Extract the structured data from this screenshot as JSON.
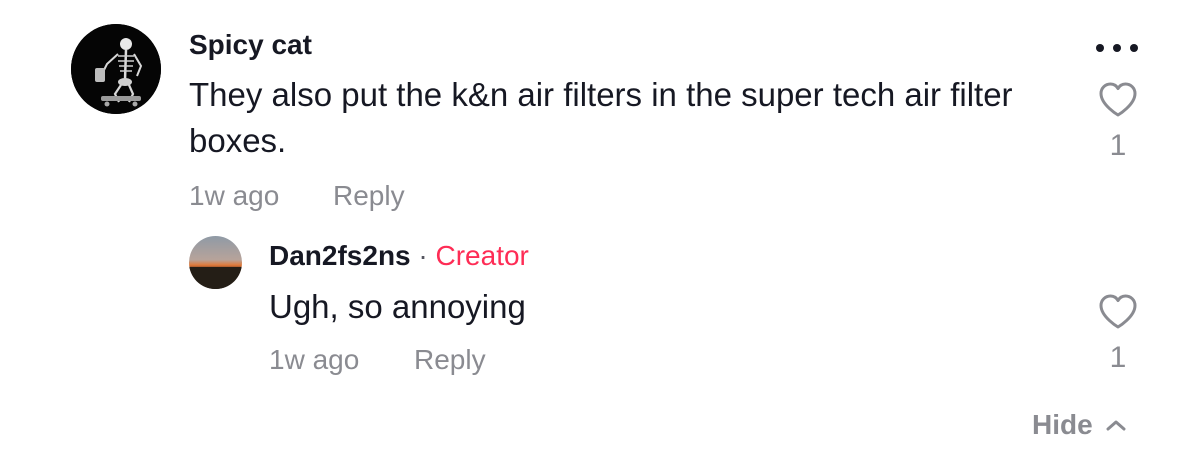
{
  "comment": {
    "username": "Spicy cat",
    "text": "They also put the k&n air filters in the super tech air filter boxes.",
    "time": "1w ago",
    "reply_label": "Reply",
    "like_count": "1",
    "avatar_icon": "skeleton-avatar-icon",
    "more_icon": "more-horizontal-icon",
    "like_icon": "heart-outline-icon"
  },
  "reply": {
    "username": "Dan2fs2ns",
    "separator": "·",
    "badge": "Creator",
    "text": "Ugh, so annoying",
    "time": "1w ago",
    "reply_label": "Reply",
    "like_count": "1",
    "avatar_icon": "sunset-avatar-icon",
    "like_icon": "heart-outline-icon"
  },
  "footer": {
    "hide_label": "Hide",
    "hide_icon": "chevron-up-icon"
  },
  "colors": {
    "text_primary": "#161823",
    "text_secondary": "#8a8b91",
    "creator_accent": "#fe2c55",
    "icon_gray": "#8a8b91"
  }
}
